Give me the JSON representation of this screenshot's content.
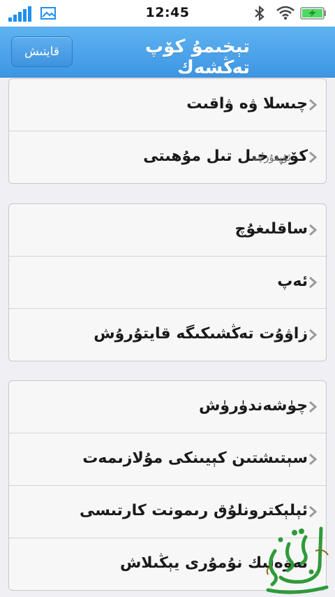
{
  "status_bar": {
    "time": "12:45",
    "icons": [
      "signal-icon",
      "image-icon",
      "bluetooth-icon",
      "wifi-icon",
      "battery-charging-icon"
    ]
  },
  "nav": {
    "title": "تېخىمۇ كۆپ تەڭشەك",
    "back_label": "قايتىش"
  },
  "groups": [
    {
      "rows": [
        {
          "label": "چىسلا ۋە ۋاقىت",
          "value": ""
        },
        {
          "label": "كۆپ خىل تىل مۇھىتى",
          "value": "ئۇيغۇرچە"
        }
      ]
    },
    {
      "rows": [
        {
          "label": "ساقلىغۇچ",
          "value": ""
        },
        {
          "label": "ئەپ",
          "value": ""
        },
        {
          "label": "زاۋۇت تەڭشىكىگە قايتۇرۇش",
          "value": ""
        }
      ]
    },
    {
      "rows": [
        {
          "label": "چۈشەندۈرۈش",
          "value": ""
        },
        {
          "label": "سېتىشتىن كېيىنكى مۇلازىمەت",
          "value": ""
        },
        {
          "label": "ئېلېكترونلۇق رىمونت كارتىسى",
          "value": ""
        },
        {
          "label": "تەۋەلىك نۇمۇرى يېڭىلاش",
          "value": ""
        }
      ]
    }
  ],
  "colors": {
    "navbar": "#4aa3ea",
    "background": "#efeff4",
    "battery_fill": "#4cd964",
    "watermark": "#2f9a3a"
  }
}
